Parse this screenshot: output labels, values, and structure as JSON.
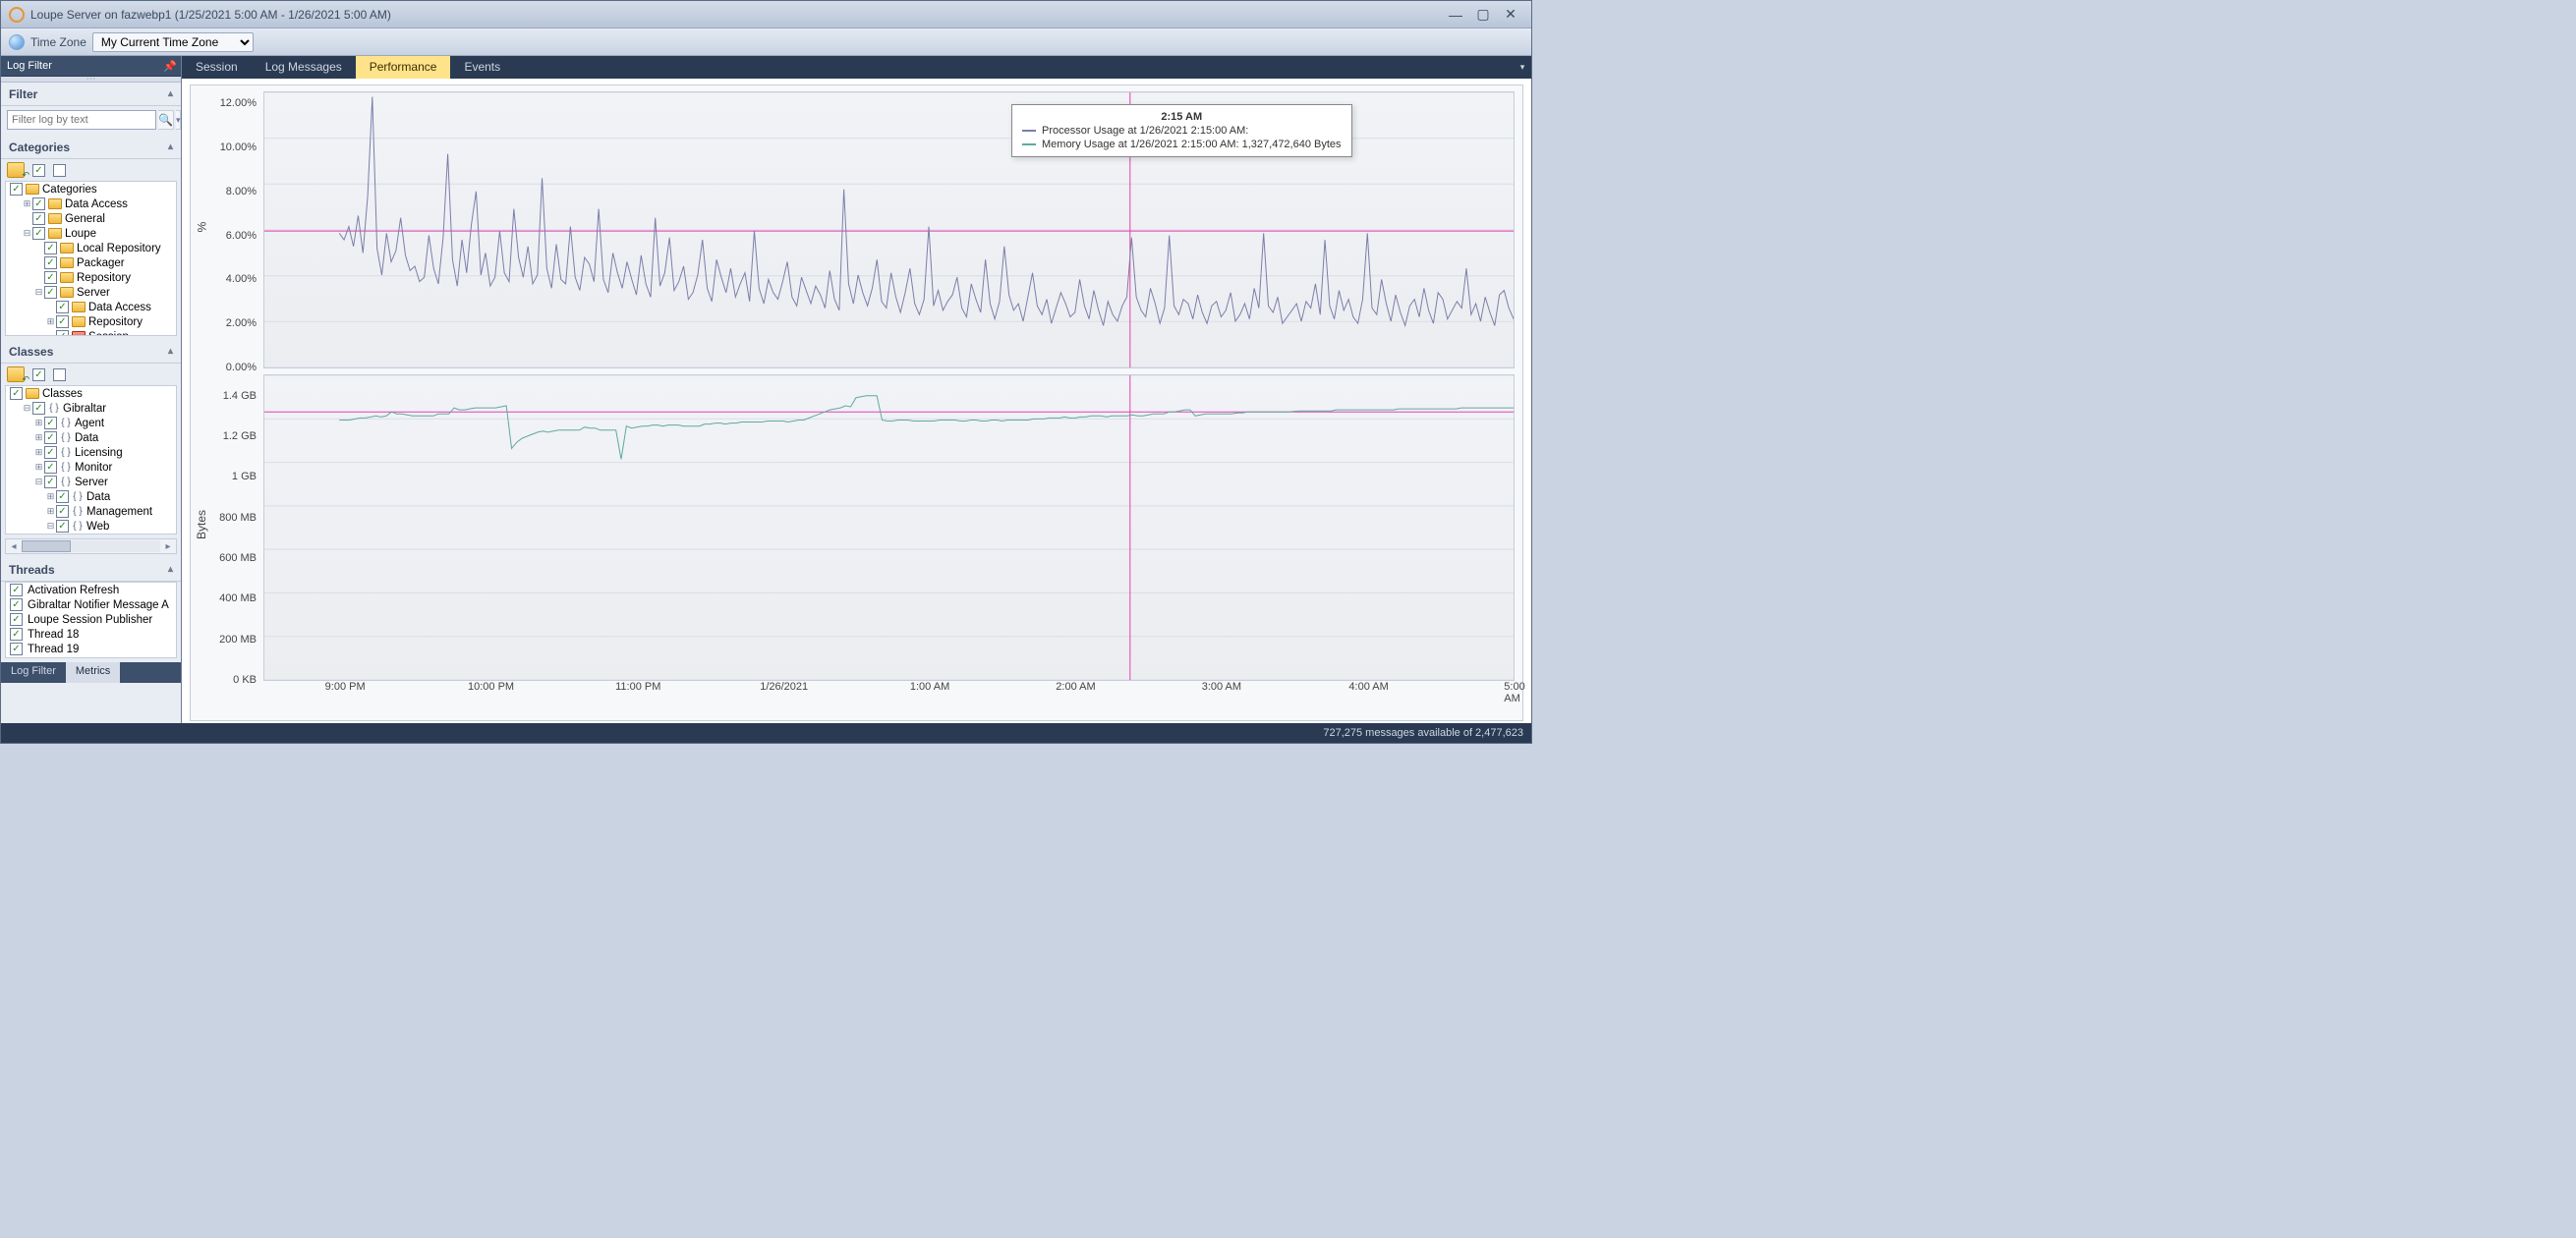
{
  "titlebar": {
    "title": "Loupe Server on fazwebp1 (1/25/2021 5:00 AM - 1/26/2021 5:00 AM)"
  },
  "toolbar": {
    "timezone_label": "Time Zone",
    "timezone_value": "My Current Time Zone"
  },
  "left": {
    "log_filter_header": "Log Filter",
    "filter_section": "Filter",
    "filter_placeholder": "Filter log by text",
    "categories_section": "Categories",
    "categories_tree": {
      "root": "Categories",
      "items": [
        "Data Access",
        "General",
        "Loupe"
      ],
      "loupe_children": [
        "Local Repository",
        "Packager",
        "Repository",
        "Server"
      ],
      "server_children": [
        "Data Access",
        "Repository",
        "Session"
      ]
    },
    "classes_section": "Classes",
    "classes_tree": {
      "root": "Classes",
      "gibraltar": "Gibraltar",
      "gibraltar_children": [
        "Agent",
        "Data",
        "Licensing",
        "Monitor",
        "Server"
      ],
      "server_children": [
        "Data",
        "Management",
        "Web"
      ]
    },
    "threads_section": "Threads",
    "threads": [
      "Activation Refresh",
      "Gibraltar Notifier Message A",
      "Loupe Session Publisher",
      "Thread 18",
      "Thread 19"
    ],
    "bottom_tabs": {
      "log_filter": "Log Filter",
      "metrics": "Metrics"
    }
  },
  "tabs": {
    "session": "Session",
    "log_messages": "Log Messages",
    "performance": "Performance",
    "events": "Events"
  },
  "chart_data": [
    {
      "type": "line",
      "title": "",
      "ylabel": "%",
      "ylim": [
        0,
        12.5
      ],
      "yticks": [
        "0.00%",
        "2.00%",
        "4.00%",
        "6.00%",
        "8.00%",
        "10.00%",
        "12.00%"
      ],
      "series": [
        {
          "name": "Processor Usage",
          "color": "#7c7ea9"
        }
      ],
      "values": [
        6.1,
        5.8,
        6.4,
        5.5,
        6.9,
        5.2,
        7.8,
        12.3,
        5.4,
        4.2,
        6.1,
        4.8,
        5.3,
        6.8,
        5.1,
        4.4,
        4.6,
        3.9,
        4.1,
        6.0,
        4.5,
        3.8,
        5.9,
        9.7,
        4.9,
        3.7,
        5.8,
        4.3,
        6.5,
        8.0,
        4.2,
        5.2,
        3.7,
        4.1,
        6.2,
        4.3,
        3.9,
        7.2,
        5.0,
        4.1,
        5.5,
        3.8,
        4.2,
        8.6,
        4.5,
        3.6,
        5.6,
        4.0,
        3.8,
        6.4,
        4.1,
        3.5,
        5.0,
        4.7,
        3.9,
        7.2,
        4.0,
        3.4,
        5.2,
        4.3,
        3.6,
        4.8,
        4.0,
        3.3,
        5.1,
        3.8,
        3.2,
        6.8,
        3.7,
        4.3,
        5.9,
        3.5,
        3.9,
        4.6,
        3.1,
        3.4,
        4.2,
        5.8,
        3.6,
        3.0,
        4.9,
        4.1,
        3.4,
        4.5,
        3.2,
        3.8,
        4.3,
        3.0,
        6.2,
        3.6,
        2.9,
        4.0,
        3.4,
        3.1,
        3.9,
        4.8,
        3.2,
        2.8,
        4.1,
        3.5,
        2.9,
        3.7,
        3.3,
        2.7,
        4.4,
        3.1,
        2.6,
        8.1,
        3.8,
        2.9,
        4.2,
        3.4,
        2.8,
        3.6,
        4.9,
        3.0,
        2.7,
        4.3,
        3.2,
        2.5,
        3.4,
        4.5,
        2.9,
        2.4,
        3.1,
        6.4,
        2.8,
        3.5,
        2.6,
        3.0,
        3.3,
        4.1,
        2.7,
        2.3,
        3.8,
        3.1,
        2.5,
        4.9,
        2.9,
        2.2,
        3.0,
        5.5,
        3.3,
        2.6,
        2.9,
        2.1,
        3.2,
        4.3,
        2.8,
        2.4,
        3.1,
        2.0,
        2.7,
        3.4,
        2.9,
        2.3,
        2.5,
        4.0,
        2.8,
        2.2,
        3.5,
        2.6,
        1.9,
        3.0,
        2.4,
        2.1,
        2.8,
        3.2,
        5.9,
        3.2,
        2.6,
        2.3,
        3.6,
        2.9,
        2.0,
        2.7,
        6.0,
        2.8,
        2.4,
        3.1,
        2.9,
        2.2,
        3.3,
        2.5,
        2.0,
        2.8,
        3.0,
        2.3,
        2.6,
        3.4,
        2.1,
        2.4,
        2.9,
        2.2,
        3.6,
        2.7,
        6.1,
        2.8,
        2.5,
        3.2,
        2.0,
        2.3,
        2.6,
        2.9,
        2.1,
        3.0,
        2.7,
        3.8,
        2.4,
        5.8,
        2.8,
        2.2,
        3.5,
        2.6,
        3.1,
        2.3,
        2.0,
        3.1,
        6.1,
        2.7,
        2.4,
        4.0,
        2.9,
        2.1,
        3.3,
        2.5,
        1.9,
        2.8,
        3.1,
        2.3,
        3.6,
        2.6,
        2.0,
        3.4,
        3.1,
        2.2,
        2.6,
        3.0,
        2.7,
        4.5,
        2.4,
        2.9,
        2.1,
        3.2,
        2.5,
        1.9,
        3.3,
        3.5,
        2.7,
        2.2
      ]
    },
    {
      "type": "line",
      "title": "",
      "ylabel": "Bytes",
      "ylim": [
        0,
        1.5
      ],
      "yticks": [
        "0 KB",
        "200 MB",
        "400 MB",
        "600 MB",
        "800 MB",
        "1 GB",
        "1.2 GB",
        "1.4 GB"
      ],
      "series": [
        {
          "name": "Memory Usage",
          "color": "#5fa99e"
        }
      ],
      "values_gb": [
        1.28,
        1.28,
        1.28,
        1.285,
        1.29,
        1.29,
        1.295,
        1.3,
        1.295,
        1.3,
        1.32,
        1.31,
        1.31,
        1.305,
        1.3,
        1.3,
        1.3,
        1.3,
        1.3,
        1.31,
        1.31,
        1.31,
        1.34,
        1.33,
        1.33,
        1.335,
        1.34,
        1.34,
        1.34,
        1.34,
        1.34,
        1.345,
        1.35,
        1.14,
        1.17,
        1.19,
        1.2,
        1.21,
        1.22,
        1.225,
        1.22,
        1.225,
        1.23,
        1.23,
        1.23,
        1.23,
        1.23,
        1.245,
        1.24,
        1.24,
        1.23,
        1.23,
        1.23,
        1.23,
        1.087,
        1.25,
        1.24,
        1.245,
        1.25,
        1.25,
        1.255,
        1.255,
        1.25,
        1.255,
        1.255,
        1.255,
        1.25,
        1.25,
        1.25,
        1.25,
        1.26,
        1.26,
        1.265,
        1.265,
        1.26,
        1.265,
        1.265,
        1.27,
        1.27,
        1.27,
        1.27,
        1.27,
        1.275,
        1.275,
        1.275,
        1.275,
        1.27,
        1.275,
        1.28,
        1.28,
        1.29,
        1.3,
        1.31,
        1.32,
        1.33,
        1.335,
        1.34,
        1.35,
        1.345,
        1.39,
        1.395,
        1.4,
        1.4,
        1.4,
        1.28,
        1.275,
        1.275,
        1.28,
        1.28,
        1.28,
        1.275,
        1.275,
        1.275,
        1.275,
        1.275,
        1.28,
        1.28,
        1.28,
        1.28,
        1.275,
        1.275,
        1.28,
        1.28,
        1.275,
        1.275,
        1.28,
        1.28,
        1.275,
        1.28,
        1.28,
        1.28,
        1.28,
        1.28,
        1.285,
        1.285,
        1.285,
        1.29,
        1.29,
        1.29,
        1.295,
        1.29,
        1.29,
        1.295,
        1.295,
        1.3,
        1.3,
        1.3,
        1.295,
        1.3,
        1.3,
        1.3,
        1.3,
        1.305,
        1.3,
        1.3,
        1.305,
        1.31,
        1.31,
        1.31,
        1.32,
        1.32,
        1.325,
        1.33,
        1.33,
        1.3,
        1.305,
        1.31,
        1.31,
        1.31,
        1.31,
        1.31,
        1.31,
        1.315,
        1.315,
        1.32,
        1.32,
        1.32,
        1.32,
        1.32,
        1.32,
        1.32,
        1.32,
        1.32,
        1.323,
        1.325,
        1.325,
        1.325,
        1.325,
        1.325,
        1.325,
        1.325,
        1.33,
        1.33,
        1.33,
        1.33,
        1.33,
        1.33,
        1.33,
        1.33,
        1.33,
        1.33,
        1.33,
        1.33,
        1.335,
        1.335,
        1.335,
        1.335,
        1.335,
        1.335,
        1.335,
        1.335,
        1.335,
        1.335,
        1.335,
        1.335,
        1.34,
        1.34,
        1.34,
        1.34,
        1.34,
        1.34,
        1.34,
        1.34,
        1.34,
        1.34,
        1.34
      ],
      "tooltip_value": "1,327,472,640 Bytes"
    }
  ],
  "xticks": [
    "9:00 PM",
    "10:00 PM",
    "11:00 PM",
    "1/26/2021",
    "1:00 AM",
    "2:00 AM",
    "3:00 AM",
    "4:00 AM",
    "5:00 AM"
  ],
  "tooltip": {
    "time": "2:15 AM",
    "line1": "Processor Usage at 1/26/2021 2:15:00 AM:",
    "line2": "Memory Usage at 1/26/2021 2:15:00 AM: 1,327,472,640 Bytes"
  },
  "status": {
    "text": "727,275 messages available of 2,477,623"
  }
}
